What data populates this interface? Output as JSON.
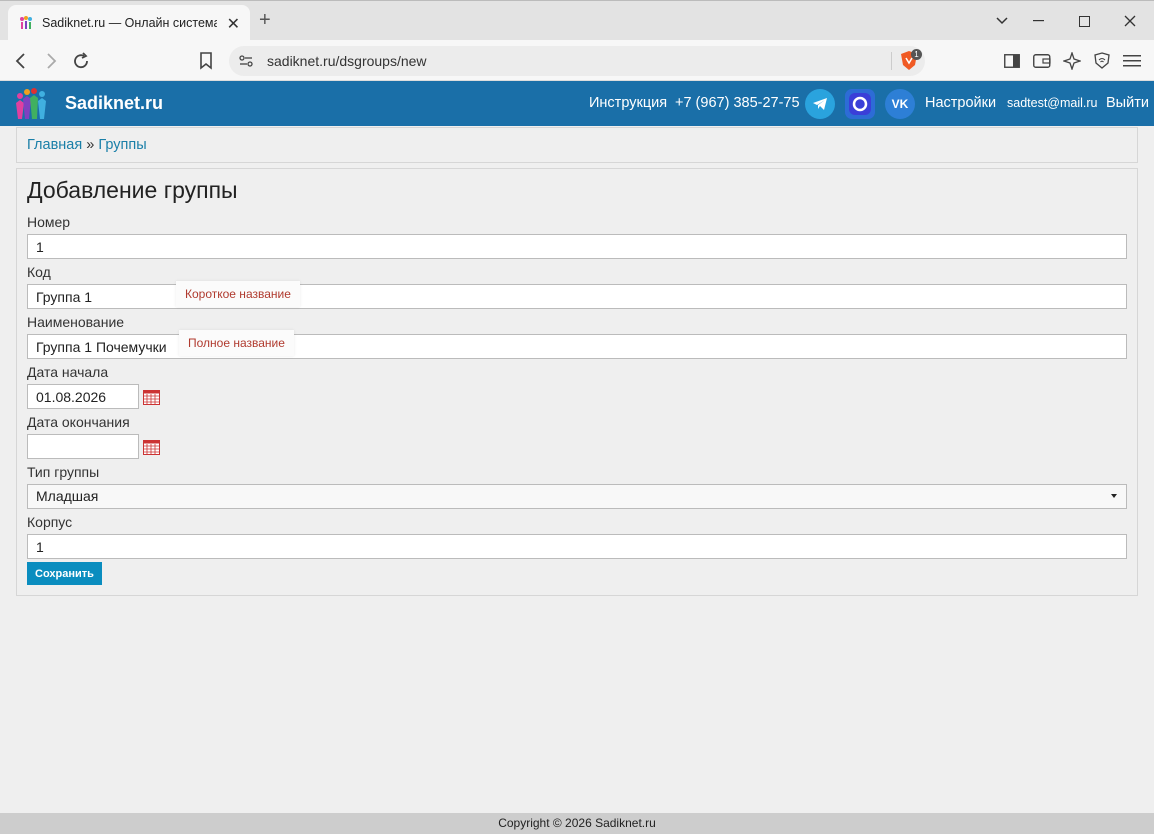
{
  "browser": {
    "tab_title": "Sadiknet.ru — Онлайн система у",
    "url": "sadiknet.ru/dsgroups/new",
    "shield_badge": "1"
  },
  "header": {
    "brand": "Sadiknet.ru",
    "instruction": "Инструкция",
    "phone": "+7 (967) 385-27-75",
    "settings": "Настройки",
    "email": "sadtest@mail.ru",
    "logout": "Выйти",
    "color": "#1a6fa8"
  },
  "breadcrumb": {
    "home": "Главная",
    "separator": "»",
    "current": "Группы"
  },
  "form": {
    "title": "Добавление группы",
    "number_label": "Номер",
    "number_value": "1",
    "code_label": "Код",
    "code_value": "Группа 1",
    "code_hint": "Короткое название",
    "name_label": "Наименование",
    "name_value": "Группа 1 Почемучки",
    "name_hint": "Полное название",
    "start_label": "Дата начала",
    "start_value": "01.08.2026",
    "end_label": "Дата окончания",
    "end_value": "",
    "type_label": "Тип группы",
    "type_value": "Младшая",
    "building_label": "Корпус",
    "building_value": "1",
    "save_label": "Сохранить"
  },
  "footer": {
    "copyright": "Copyright © 2026 Sadiknet.ru"
  }
}
